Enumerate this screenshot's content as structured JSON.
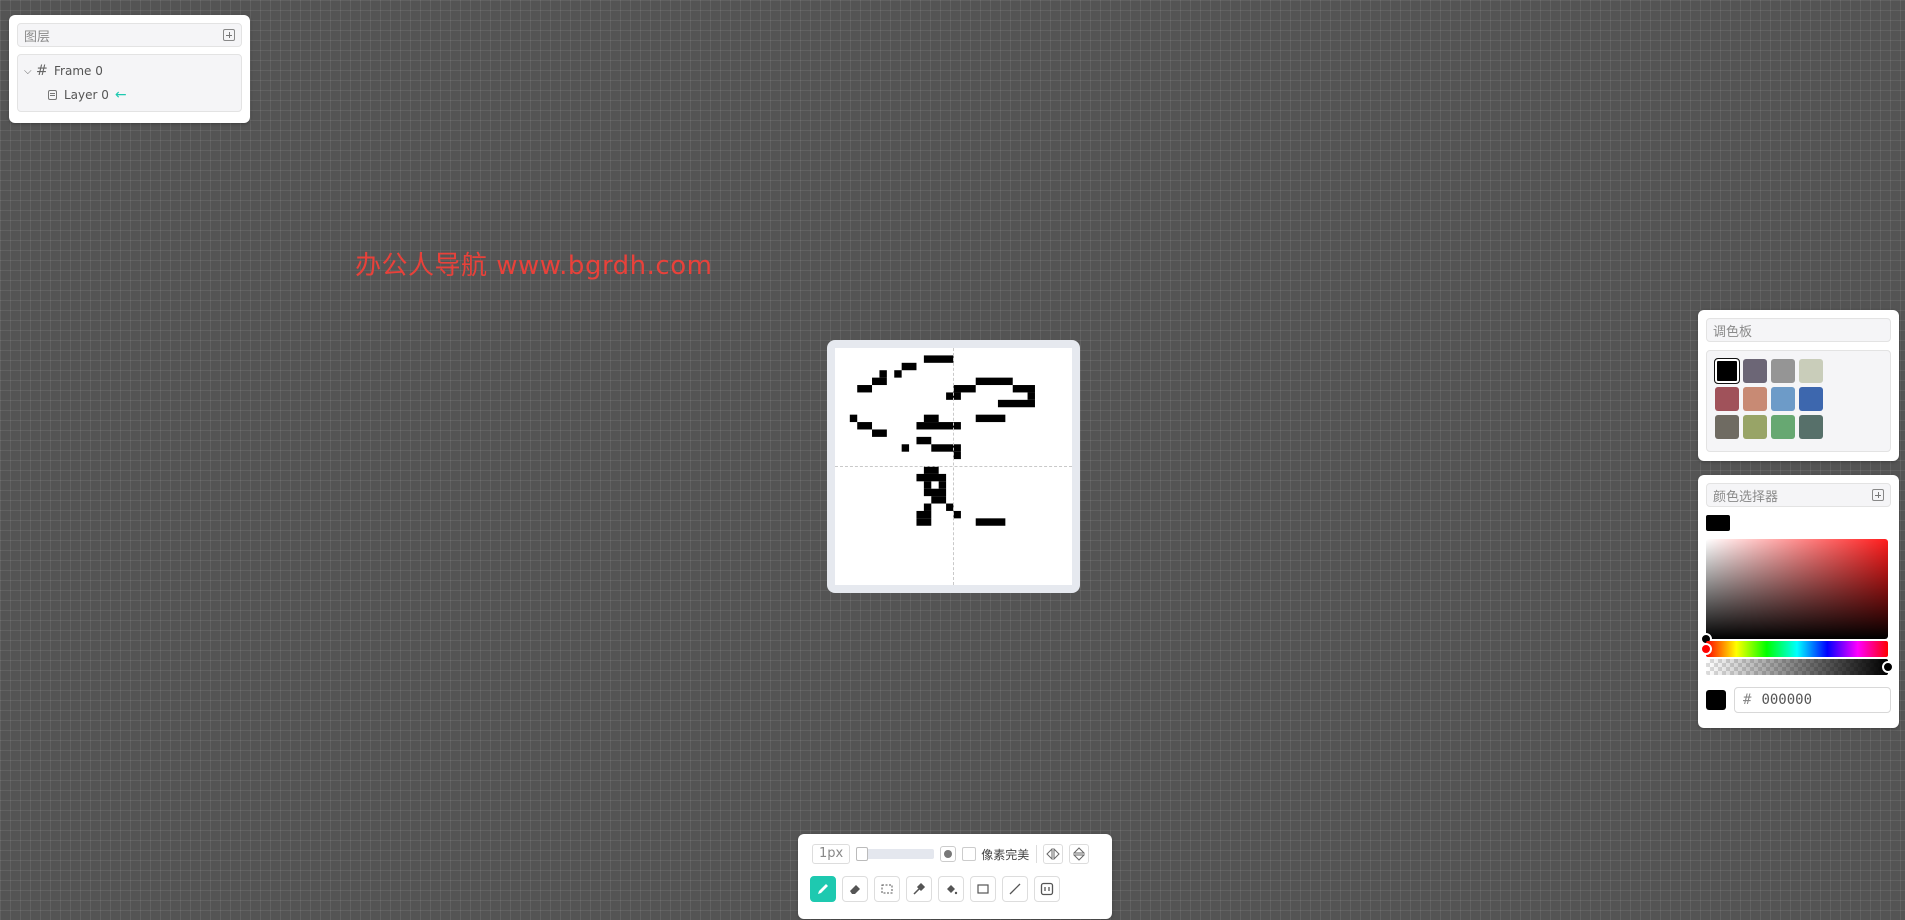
{
  "layers_panel": {
    "title": "图层",
    "frame_name": "Frame 0",
    "layer_name": "Layer 0"
  },
  "watermark": "办公人导航  www.bgrdh.com",
  "palette_panel": {
    "title": "调色板",
    "swatches": [
      "#000000",
      "#6c6676",
      "#959595",
      "#c9cdba",
      "#a0525a",
      "#c88a74",
      "#6d9bc8",
      "#3d67ae",
      "#6f6b62",
      "#98a467",
      "#67a872",
      "#57706a"
    ],
    "selected_index": 0
  },
  "color_picker": {
    "title": "颜色选择器",
    "current_color": "#000000",
    "hue_color": "#ff0000",
    "hex_prefix": "#",
    "hex_value": "000000"
  },
  "toolbar": {
    "brush_size": "1px",
    "brush_size_slider_fraction": 0,
    "pixel_perfect_label": "像素完美",
    "pixel_perfect_checked": false,
    "accent_color": "#1ec9b0",
    "tools": [
      "pencil",
      "eraser",
      "select",
      "eyedropper",
      "fill",
      "rectangle",
      "line",
      "frame"
    ],
    "active_tool": "pencil"
  },
  "canvas": {
    "background": "#ffffff",
    "pixel_color": "#000000",
    "grid_cells": 32,
    "pixel_rows": [
      "........##########.......",
      "......................"
    ],
    "drawing": [
      [
        12,
        1,
        4,
        1
      ],
      [
        9,
        2,
        2,
        1
      ],
      [
        8,
        3,
        1,
        1
      ],
      [
        6,
        3,
        1,
        1
      ],
      [
        5,
        4,
        2,
        1
      ],
      [
        3,
        5,
        2,
        1
      ],
      [
        19,
        4,
        5,
        1
      ],
      [
        16,
        5,
        3,
        1
      ],
      [
        24,
        5,
        3,
        1
      ],
      [
        15,
        6,
        2,
        1
      ],
      [
        26,
        6,
        1,
        1
      ],
      [
        22,
        7,
        5,
        1
      ],
      [
        2,
        9,
        1,
        1
      ],
      [
        19,
        9,
        4,
        1
      ],
      [
        3,
        10,
        2,
        1
      ],
      [
        12,
        9,
        2,
        1
      ],
      [
        11,
        10,
        6,
        1
      ],
      [
        5,
        11,
        2,
        1
      ],
      [
        11,
        12,
        2,
        1
      ],
      [
        13,
        13,
        4,
        1
      ],
      [
        9,
        13,
        1,
        1
      ],
      [
        16,
        14,
        1,
        1
      ],
      [
        12,
        16,
        2,
        1
      ],
      [
        11,
        17,
        4,
        1
      ],
      [
        12,
        18,
        1,
        1
      ],
      [
        14,
        18,
        1,
        1
      ],
      [
        12,
        19,
        3,
        1
      ],
      [
        13,
        20,
        2,
        1
      ],
      [
        15,
        21,
        1,
        1
      ],
      [
        12,
        21,
        1,
        1
      ],
      [
        11,
        22,
        2,
        1
      ],
      [
        16,
        22,
        1,
        1
      ],
      [
        11,
        23,
        2,
        1
      ],
      [
        19,
        23,
        4,
        1
      ]
    ]
  }
}
